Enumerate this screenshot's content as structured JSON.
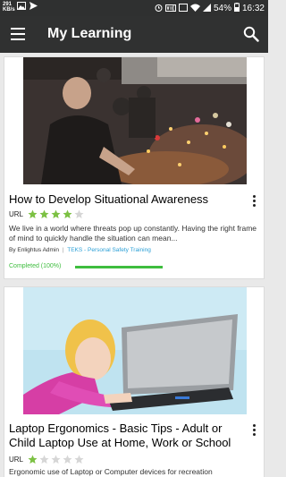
{
  "status_bar": {
    "carrier": "291 KB/s",
    "battery": "54%",
    "time": "16:32",
    "icons": [
      "image-icon",
      "send-icon",
      "alarm-icon",
      "volte-icon",
      "cast-icon",
      "wifi-icon",
      "signal-icon",
      "battery-icon"
    ]
  },
  "app_bar": {
    "title": "My Learning",
    "menu_icon": "menu-icon",
    "search_icon": "search-icon"
  },
  "courses": [
    {
      "title": "How to Develop Situational Awareness",
      "type_label": "URL",
      "rating": 4,
      "rating_max": 5,
      "description": "We live in a world where threats pop up constantly. Having the right frame of mind to quickly handle the situation can mean...",
      "author": "By Enlightus Admin",
      "separator": "|",
      "category": "TEKS - Personal Safety Training",
      "completed_label": "Completed (100%)",
      "progress_fraction": 1.0
    },
    {
      "title": "Laptop Ergonomics - Basic Tips - Adult or Child Laptop Use at Home, Work or School",
      "type_label": "URL",
      "rating": 1,
      "rating_max": 5,
      "description": "Ergonomic use of Laptop or Computer devices for recreation"
    }
  ],
  "colors": {
    "app_bar": "#303131",
    "star_filled": "#7cc143",
    "star_empty": "#d6d6d6",
    "progress": "#3ebd3e",
    "category_link": "#2a9fd6"
  }
}
